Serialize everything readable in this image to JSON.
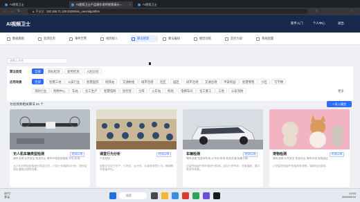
{
  "browser": {
    "tabs": [
      {
        "title": "AI视频卫士",
        "active": false
      },
      {
        "title": "AI视频卫士产品操作说明视频演示-...",
        "active": true
      },
      {
        "title": "AI视频卫士",
        "active": false
      }
    ],
    "url": "192.168.71.126:45206/vis_oem/algorithm",
    "security": "▲ 不安全"
  },
  "app": {
    "logo": "AI视频卫士",
    "notifications": "新手入门",
    "user": "个人中心",
    "logout": "退出"
  },
  "nav": [
    {
      "label": "数据看板",
      "active": false
    },
    {
      "label": "监测任务",
      "active": false
    },
    {
      "label": "事件告警",
      "active": false
    },
    {
      "label": "视频接入",
      "active": false
    },
    {
      "label": "算法管理",
      "active": true
    },
    {
      "label": "算法编排",
      "active": false
    },
    {
      "label": "模型训练",
      "active": false
    },
    {
      "label": "监控大屏",
      "active": false
    },
    {
      "label": "系统配置",
      "active": false
    }
  ],
  "search_placeholder": "请输入名称",
  "filters": {
    "type_label": "算法类型",
    "types": [
      "全部",
      "目标检测",
      "姿势检测",
      "人脸识别"
    ],
    "scene_label": "应用场景",
    "scenes_row1": [
      "全部",
      "智慧工地",
      "公安行业",
      "智慧医院",
      "地铁站",
      "交通枢纽",
      "城市治理",
      "社区",
      "园区",
      "城市治理",
      "交通治理",
      "平安校园",
      "智慧零售",
      "小区",
      "写字楼"
    ],
    "scenes_row2": [
      "消防行业",
      "购物中心",
      "车站",
      "化工生产",
      "智慧电网",
      "监控室",
      "仓库",
      "火车站",
      "机场",
      "电梯车间",
      "化工重工",
      "工地",
      "公安消防"
    ],
    "more": "更多"
  },
  "count_title": "为您找到相关算法 61 个",
  "import_button": "+ 导入模型",
  "cards": [
    {
      "title": "无人机车辆类型检测",
      "badge": "检测示例",
      "scene": "城市治理 公共安全 智慧社区 城市环境智慧管理 车站 机场",
      "desc": "无人机对地面车辆进行类型识别，可用于交通路况分析、违停监测及道路治理等场景。"
    },
    {
      "title": "课堂行为分析",
      "badge": "检测示例",
      "scene": "平安校园",
      "desc": "智能识别学生举手、打哈欠、玩手机、趴桌等课堂行为，辅助教学质量评估。"
    },
    {
      "title": "车辆检测",
      "badge": "检测示例",
      "scene": "城市治理 智慧停车场 火车站 机场 智慧交通 高速公路",
      "desc": "对监控画面中的车辆进行检测，适用于停车场、交通道路、路口等多种场景。"
    },
    {
      "title": "宠物检测",
      "badge": "检测示例",
      "scene": "城市治理 公共安全 智慧社区 城市环境 智慧园区",
      "desc": "识别监控画面中的猫狗等宠物，辅助社区管理。"
    }
  ],
  "taskbar": {
    "weather": "26°C",
    "weather_desc": "多云",
    "search": "搜索",
    "time": "13:53",
    "date": "2025/06/24"
  },
  "colors": {
    "header": "#172a4e",
    "accent": "#2f6bff"
  }
}
